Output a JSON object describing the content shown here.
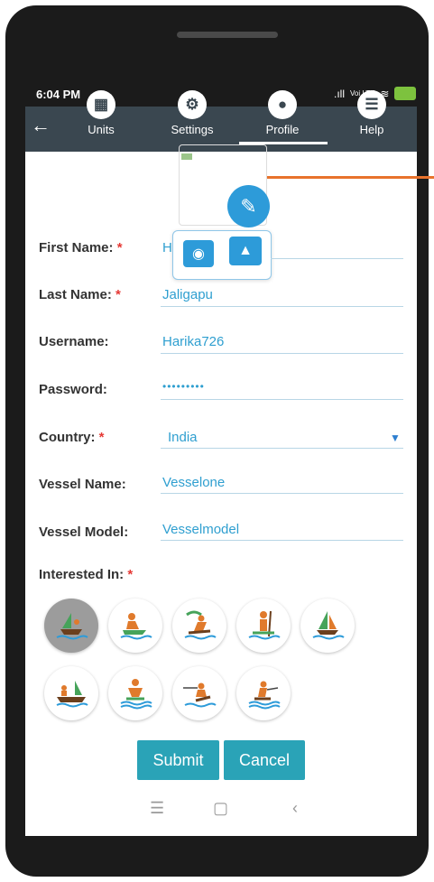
{
  "status": {
    "time": "6:04 PM",
    "network": "Voi LTE"
  },
  "nav": {
    "items": [
      {
        "label": "Units",
        "icon": "units-icon"
      },
      {
        "label": "Settings",
        "icon": "gear-icon"
      },
      {
        "label": "Profile",
        "icon": "user-icon"
      },
      {
        "label": "Help",
        "icon": "list-icon"
      }
    ],
    "active": "Profile"
  },
  "form": {
    "first_name": {
      "label": "First Name:",
      "value": "H",
      "required": "*"
    },
    "last_name": {
      "label": "Last Name:",
      "value": "Jaligapu",
      "required": "*"
    },
    "username": {
      "label": "Username:",
      "value": "Harika726"
    },
    "password": {
      "label": "Password:",
      "value": "•••••••••"
    },
    "country": {
      "label": "Country:",
      "value": "India",
      "required": "*"
    },
    "vessel_name": {
      "label": "Vessel Name:",
      "value": "Vesselone"
    },
    "vessel_model": {
      "label": "Vessel Model:",
      "value": "Vesselmodel"
    },
    "interested": {
      "label": "Interested In:",
      "required": "*"
    }
  },
  "interests": [
    {
      "name": "fishing",
      "selected": true
    },
    {
      "name": "jet-ski",
      "selected": false
    },
    {
      "name": "kitesurfing",
      "selected": false
    },
    {
      "name": "paddleboarding",
      "selected": false
    },
    {
      "name": "sailing",
      "selected": false
    },
    {
      "name": "boating",
      "selected": false
    },
    {
      "name": "surfing",
      "selected": false
    },
    {
      "name": "wakeboarding",
      "selected": false
    },
    {
      "name": "water-skiing",
      "selected": false
    }
  ],
  "buttons": {
    "submit": "Submit",
    "cancel": "Cancel"
  },
  "colors": {
    "accent": "#2d9bd9",
    "navbar": "#3a4750",
    "button": "#2aa3b7",
    "required": "#e53935",
    "highlight": "#e8722c"
  }
}
